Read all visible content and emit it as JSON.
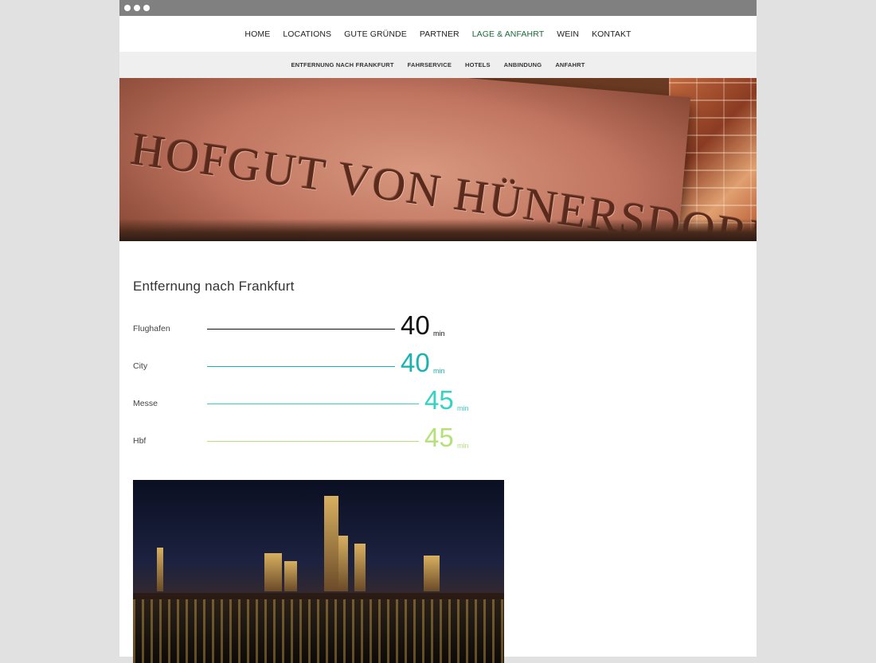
{
  "window": {
    "dots": 3
  },
  "main_nav": {
    "items": [
      {
        "label": "HOME"
      },
      {
        "label": "LOCATIONS"
      },
      {
        "label": "GUTE GRÜNDE"
      },
      {
        "label": "PARTNER"
      },
      {
        "label": "LAGE & ANFAHRT",
        "active": true
      },
      {
        "label": "WEIN"
      },
      {
        "label": "KONTAKT"
      }
    ],
    "active_color": "#1b6b3c"
  },
  "sub_nav": {
    "items": [
      {
        "label": "ENTFERNUNG NACH FRANKFURT"
      },
      {
        "label": "FAHRSERVICE"
      },
      {
        "label": "HOTELS"
      },
      {
        "label": "ANBINDUNG"
      },
      {
        "label": "ANFAHRT"
      }
    ]
  },
  "hero": {
    "engraved_text": "HOFGUT VON HÜNERSDORFF"
  },
  "distances": {
    "title": "Entfernung nach Frankfurt",
    "rows": [
      {
        "label": "Flughafen",
        "value": "40",
        "unit": "min",
        "color": "#111111"
      },
      {
        "label": "City",
        "value": "40",
        "unit": "min",
        "color": "#1ab3b0"
      },
      {
        "label": "Messe",
        "value": "45",
        "unit": "min",
        "color": "#34d3c2"
      },
      {
        "label": "Hbf",
        "value": "45",
        "unit": "min",
        "color": "#b5e07a"
      }
    ]
  }
}
